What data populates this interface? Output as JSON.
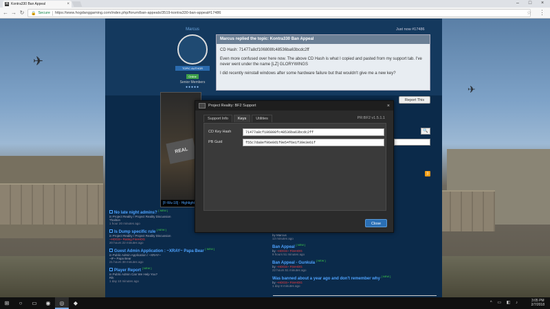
{
  "browser": {
    "tab_title": "Kontra330 Ban Appeal",
    "tab_favicon": "H",
    "secure_label": "Secure",
    "url": "https://www.hogdanggaming.com/index.php/forum/ban-appeals/3519-kontra330-ban-appeal#17486"
  },
  "post": {
    "author_name": "Marcus",
    "author_badge": "TOPIC AUTHOR",
    "online_label": "Online",
    "rank": "Senior Members",
    "time": "Just now #17486",
    "header": "Marcus replied the topic: Kontra330 Ban Appeal",
    "line1": "CD Hash: 71477a8cf106808fc48536ba63bcdc2ff",
    "line2": "Even more confused over here now. The above CD Hash is what I copied and pasted from my support tab. I've never went under the name [LZ] GLORYWINGS",
    "line3": "I did recently reinstall windows after some hardware failure but that wouldn't give me a new key?",
    "report_label": "Report This"
  },
  "banner": {
    "caption": "[F-Wu-18] - Highlight",
    "logo_text": "REAL"
  },
  "modal": {
    "title": "Project Reality: BF2 Support",
    "tabs": [
      "Support Info",
      "Keys",
      "Utilities"
    ],
    "active_tab": 1,
    "version": "PR:BF2 v1.5.1.1",
    "cd_key_label": "CD Key Hash",
    "cd_key_value": "71477a8cf106808fc48536ba63bcdc2ff",
    "pb_label": "PB Guid",
    "pb_value": "f55c7da8ef96e0d1f9e54f6e1f39e3e61f",
    "close_label": "Close"
  },
  "topics_left": [
    {
      "title": "No late night admins?",
      "new": "[ NEW ]",
      "by": "in Project Reality / Project Reality Discussion",
      "user": "Thaliton",
      "time": "1 hour 20 minutes ago"
    },
    {
      "title": "Is Dump specific rule",
      "new": "[ NEW ]",
      "by": "in Project Reality / Project Reality Discussion",
      "user": "~HOGS~ Rating FireHOG",
      "time": "20 hours 22 minutes ago"
    },
    {
      "title": "Guest Admin Application : ~XRAY~ Papa Bear",
      "new": "[ NEW ]",
      "by": "in Public Admin Application / ~XRAY~",
      "user": "~IF~ Papa Bear",
      "time": "21 hours 38 minutes ago"
    },
    {
      "title": "Player Report",
      "new": "[ NEW ]",
      "by": "in Public Admin Can We Help You?",
      "user": "Rik",
      "time": "1 day 10 minutes ago"
    }
  ],
  "topics_right": [
    {
      "title": "",
      "new": "",
      "by": "",
      "user": "Marcus",
      "time": "13 minutes ago"
    },
    {
      "title": "Ban Appeal",
      "new": "[ NEW ]",
      "by": "",
      "user": "~HOGS~ FireHOG",
      "time": "9 hours 51 minutes ago"
    },
    {
      "title": "Ban Appeal - Gunkula",
      "new": "[ NEW ]",
      "by": "",
      "user": "~HOGS~ FireHOG",
      "time": "22 hours 51 minutes ago"
    },
    {
      "title": "Was banned about a year ago and don't remember why",
      "new": "[ NEW ]",
      "by": "",
      "user": "~HOGS~ FireHOG",
      "time": "1 day 8 minutes ago"
    }
  ],
  "taskbar": {
    "time": "3:05 PM",
    "date": "2/7/2018"
  }
}
